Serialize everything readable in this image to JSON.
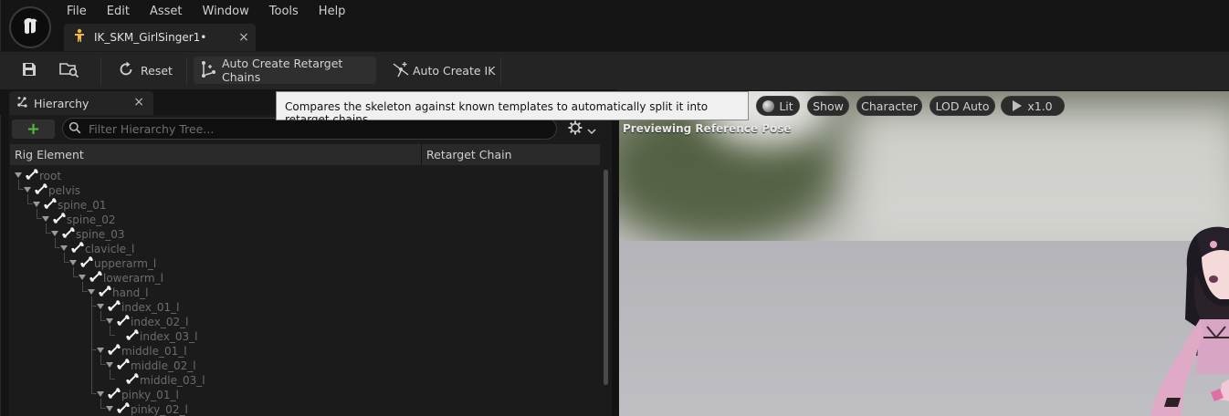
{
  "menu": [
    "File",
    "Edit",
    "Asset",
    "Window",
    "Tools",
    "Help"
  ],
  "document_tab": {
    "title": "IK_SKM_GirlSinger1•",
    "close": "×"
  },
  "toolbar": {
    "reset_label": "Reset",
    "auto_chains_label": "Auto Create Retarget Chains",
    "auto_ik_label": "Auto Create IK"
  },
  "tooltip": "Compares the skeleton against known templates to automatically split it into retarget chains.",
  "hierarchy": {
    "tab_label": "Hierarchy",
    "close": "×",
    "add": "+",
    "search_placeholder": "Filter Hierarchy Tree...",
    "columns": [
      "Rig Element",
      "Retarget Chain"
    ],
    "rows": [
      {
        "name": "root",
        "depth": 0
      },
      {
        "name": "pelvis",
        "depth": 1
      },
      {
        "name": "spine_01",
        "depth": 2
      },
      {
        "name": "spine_02",
        "depth": 3
      },
      {
        "name": "spine_03",
        "depth": 4
      },
      {
        "name": "clavicle_l",
        "depth": 5
      },
      {
        "name": "upperarm_l",
        "depth": 6
      },
      {
        "name": "lowerarm_l",
        "depth": 7
      },
      {
        "name": "hand_l",
        "depth": 8
      },
      {
        "name": "index_01_l",
        "depth": 9
      },
      {
        "name": "index_02_l",
        "depth": 10
      },
      {
        "name": "index_03_l",
        "depth": 11,
        "leaf": true
      },
      {
        "name": "middle_01_l",
        "depth": 9
      },
      {
        "name": "middle_02_l",
        "depth": 10
      },
      {
        "name": "middle_03_l",
        "depth": 11,
        "leaf": true
      },
      {
        "name": "pinky_01_l",
        "depth": 9
      },
      {
        "name": "pinky_02_l",
        "depth": 10
      }
    ]
  },
  "viewport": {
    "lit": "Lit",
    "show": "Show",
    "character": "Character",
    "lod": "LOD Auto",
    "speed": "x1.0",
    "overlay_text": "Previewing Reference Pose"
  },
  "colors": {
    "accent_green": "#4fbf3a",
    "panel": "#1b1b1b",
    "toolbar": "#242424"
  }
}
